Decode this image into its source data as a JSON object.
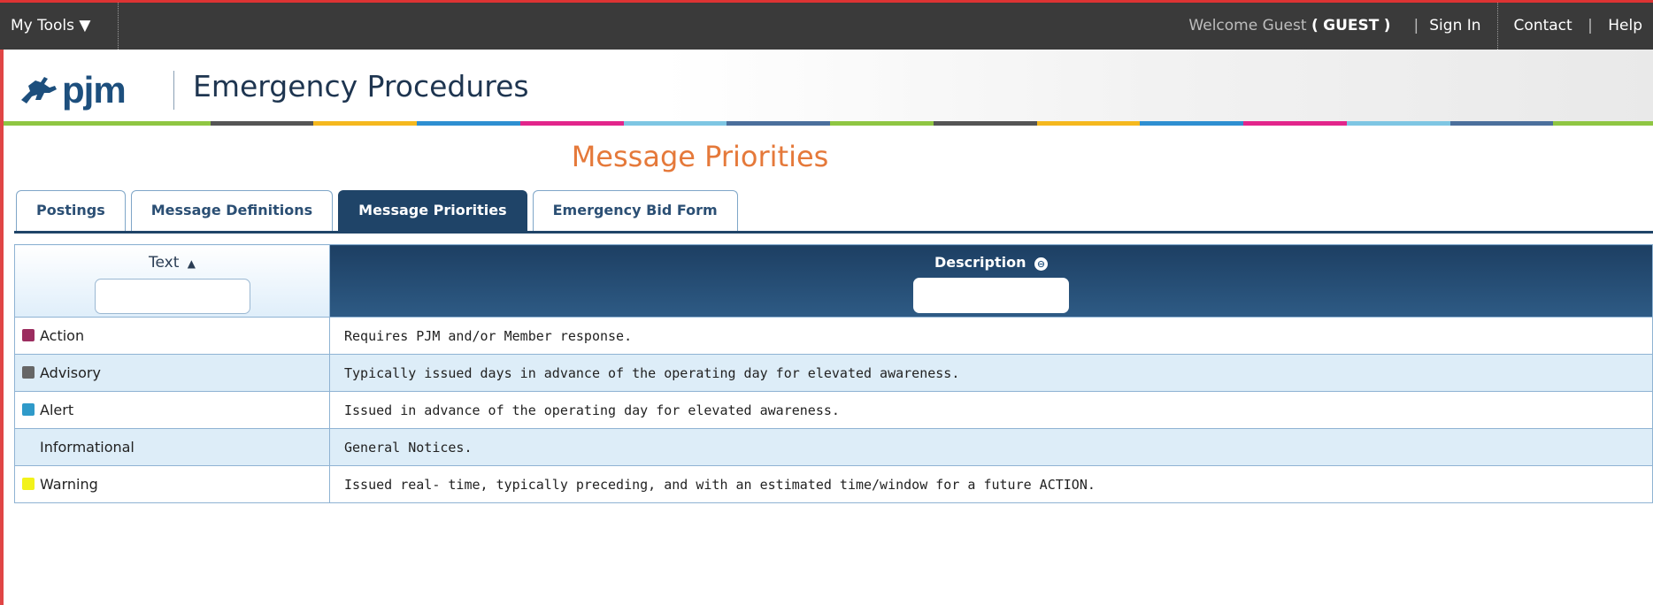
{
  "topbar": {
    "tools_label": "My Tools ▼",
    "welcome_prefix": "Welcome Guest",
    "welcome_user_open": "(",
    "welcome_user": "GUEST",
    "welcome_user_close": ")",
    "sep1": "|",
    "sign_in": "Sign In",
    "contact": "Contact",
    "sep2": "|",
    "help": "Help"
  },
  "header": {
    "logo_text": "pjm",
    "app_title": "Emergency Procedures",
    "stripe_colors": [
      "#8fc642",
      "#8fc642",
      "#555555",
      "#f5b81e",
      "#2e8fd1",
      "#e2258b",
      "#7ec6e3",
      "#4b6f9c",
      "#8fc642",
      "#555555",
      "#f5b81e",
      "#2e8fd1",
      "#e2258b",
      "#7ec6e3",
      "#4b6f9c",
      "#8fc642"
    ]
  },
  "page": {
    "title": "Message Priorities"
  },
  "tabs": [
    {
      "label": "Postings",
      "active": false
    },
    {
      "label": "Message Definitions",
      "active": false
    },
    {
      "label": "Message Priorities",
      "active": true
    },
    {
      "label": "Emergency Bid Form",
      "active": false
    }
  ],
  "grid": {
    "columns": {
      "text": "Text",
      "text_sort_icon": "▲",
      "description": "Description",
      "description_icon": "⊖"
    },
    "rows": [
      {
        "text": "Action",
        "color": "#9b2d5f",
        "description": "Requires PJM and/or Member response."
      },
      {
        "text": "Advisory",
        "color": "#666666",
        "description": "Typically issued days in advance of the operating day for elevated awareness."
      },
      {
        "text": "Alert",
        "color": "#2f9ac9",
        "description": "Issued in advance of the operating day for elevated awareness."
      },
      {
        "text": "Informational",
        "color": "",
        "description": "General Notices."
      },
      {
        "text": "Warning",
        "color": "#f2f21a",
        "description": "Issued real- time, typically preceding, and with an estimated time/window for a future ACTION."
      }
    ]
  }
}
